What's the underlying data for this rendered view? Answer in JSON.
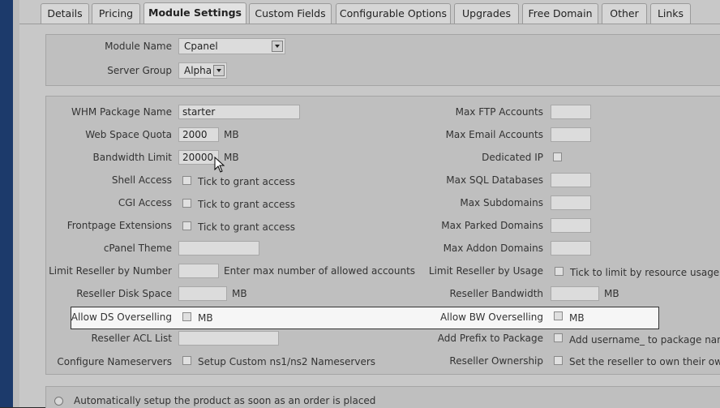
{
  "tabs": [
    {
      "label": "Details"
    },
    {
      "label": "Pricing"
    },
    {
      "label": "Module Settings"
    },
    {
      "label": "Custom Fields"
    },
    {
      "label": "Configurable Options"
    },
    {
      "label": "Upgrades"
    },
    {
      "label": "Free Domain"
    },
    {
      "label": "Other"
    },
    {
      "label": "Links"
    }
  ],
  "module": {
    "module_name_label": "Module Name",
    "module_name_value": "Cpanel",
    "server_group_label": "Server Group",
    "server_group_value": "Alpha"
  },
  "left": {
    "whm_label": "WHM Package Name",
    "whm_value": "starter",
    "webspace_label": "Web Space Quota",
    "webspace_value": "2000",
    "webspace_unit": "MB",
    "bandwidth_label": "Bandwidth Limit",
    "bandwidth_value": "20000",
    "bandwidth_unit": "MB",
    "shell_label": "Shell Access",
    "shell_text": "Tick to grant access",
    "cgi_label": "CGI Access",
    "cgi_text": "Tick to grant access",
    "frontpage_label": "Frontpage Extensions",
    "frontpage_text": "Tick to grant access",
    "theme_label": "cPanel Theme",
    "limitnum_label": "Limit Reseller by Number",
    "limitnum_text": "Enter max number of allowed accounts",
    "diskspace_label": "Reseller Disk Space",
    "diskspace_unit": "MB",
    "dsover_label": "Allow DS Overselling",
    "dsover_unit": "MB",
    "acl_label": "Reseller ACL List",
    "ns_label": "Configure Nameservers",
    "ns_text": "Setup Custom ns1/ns2 Nameservers"
  },
  "right": {
    "ftp_label": "Max FTP Accounts",
    "email_label": "Max Email Accounts",
    "dedip_label": "Dedicated IP",
    "sql_label": "Max SQL Databases",
    "subdom_label": "Max Subdomains",
    "parked_label": "Max Parked Domains",
    "addon_label": "Max Addon Domains",
    "limituse_label": "Limit Reseller by Usage",
    "limituse_text": "Tick to limit by resource usage",
    "resbw_label": "Reseller Bandwidth",
    "resbw_unit": "MB",
    "bwover_label": "Allow BW Overselling",
    "bwover_unit": "MB",
    "prefix_label": "Add Prefix to Package",
    "prefix_text": "Add username_ to package name",
    "ownership_label": "Reseller Ownership",
    "ownership_text": "Set the reseller to own their own"
  },
  "auto_setup_text": "Automatically setup the product as soon as an order is placed"
}
